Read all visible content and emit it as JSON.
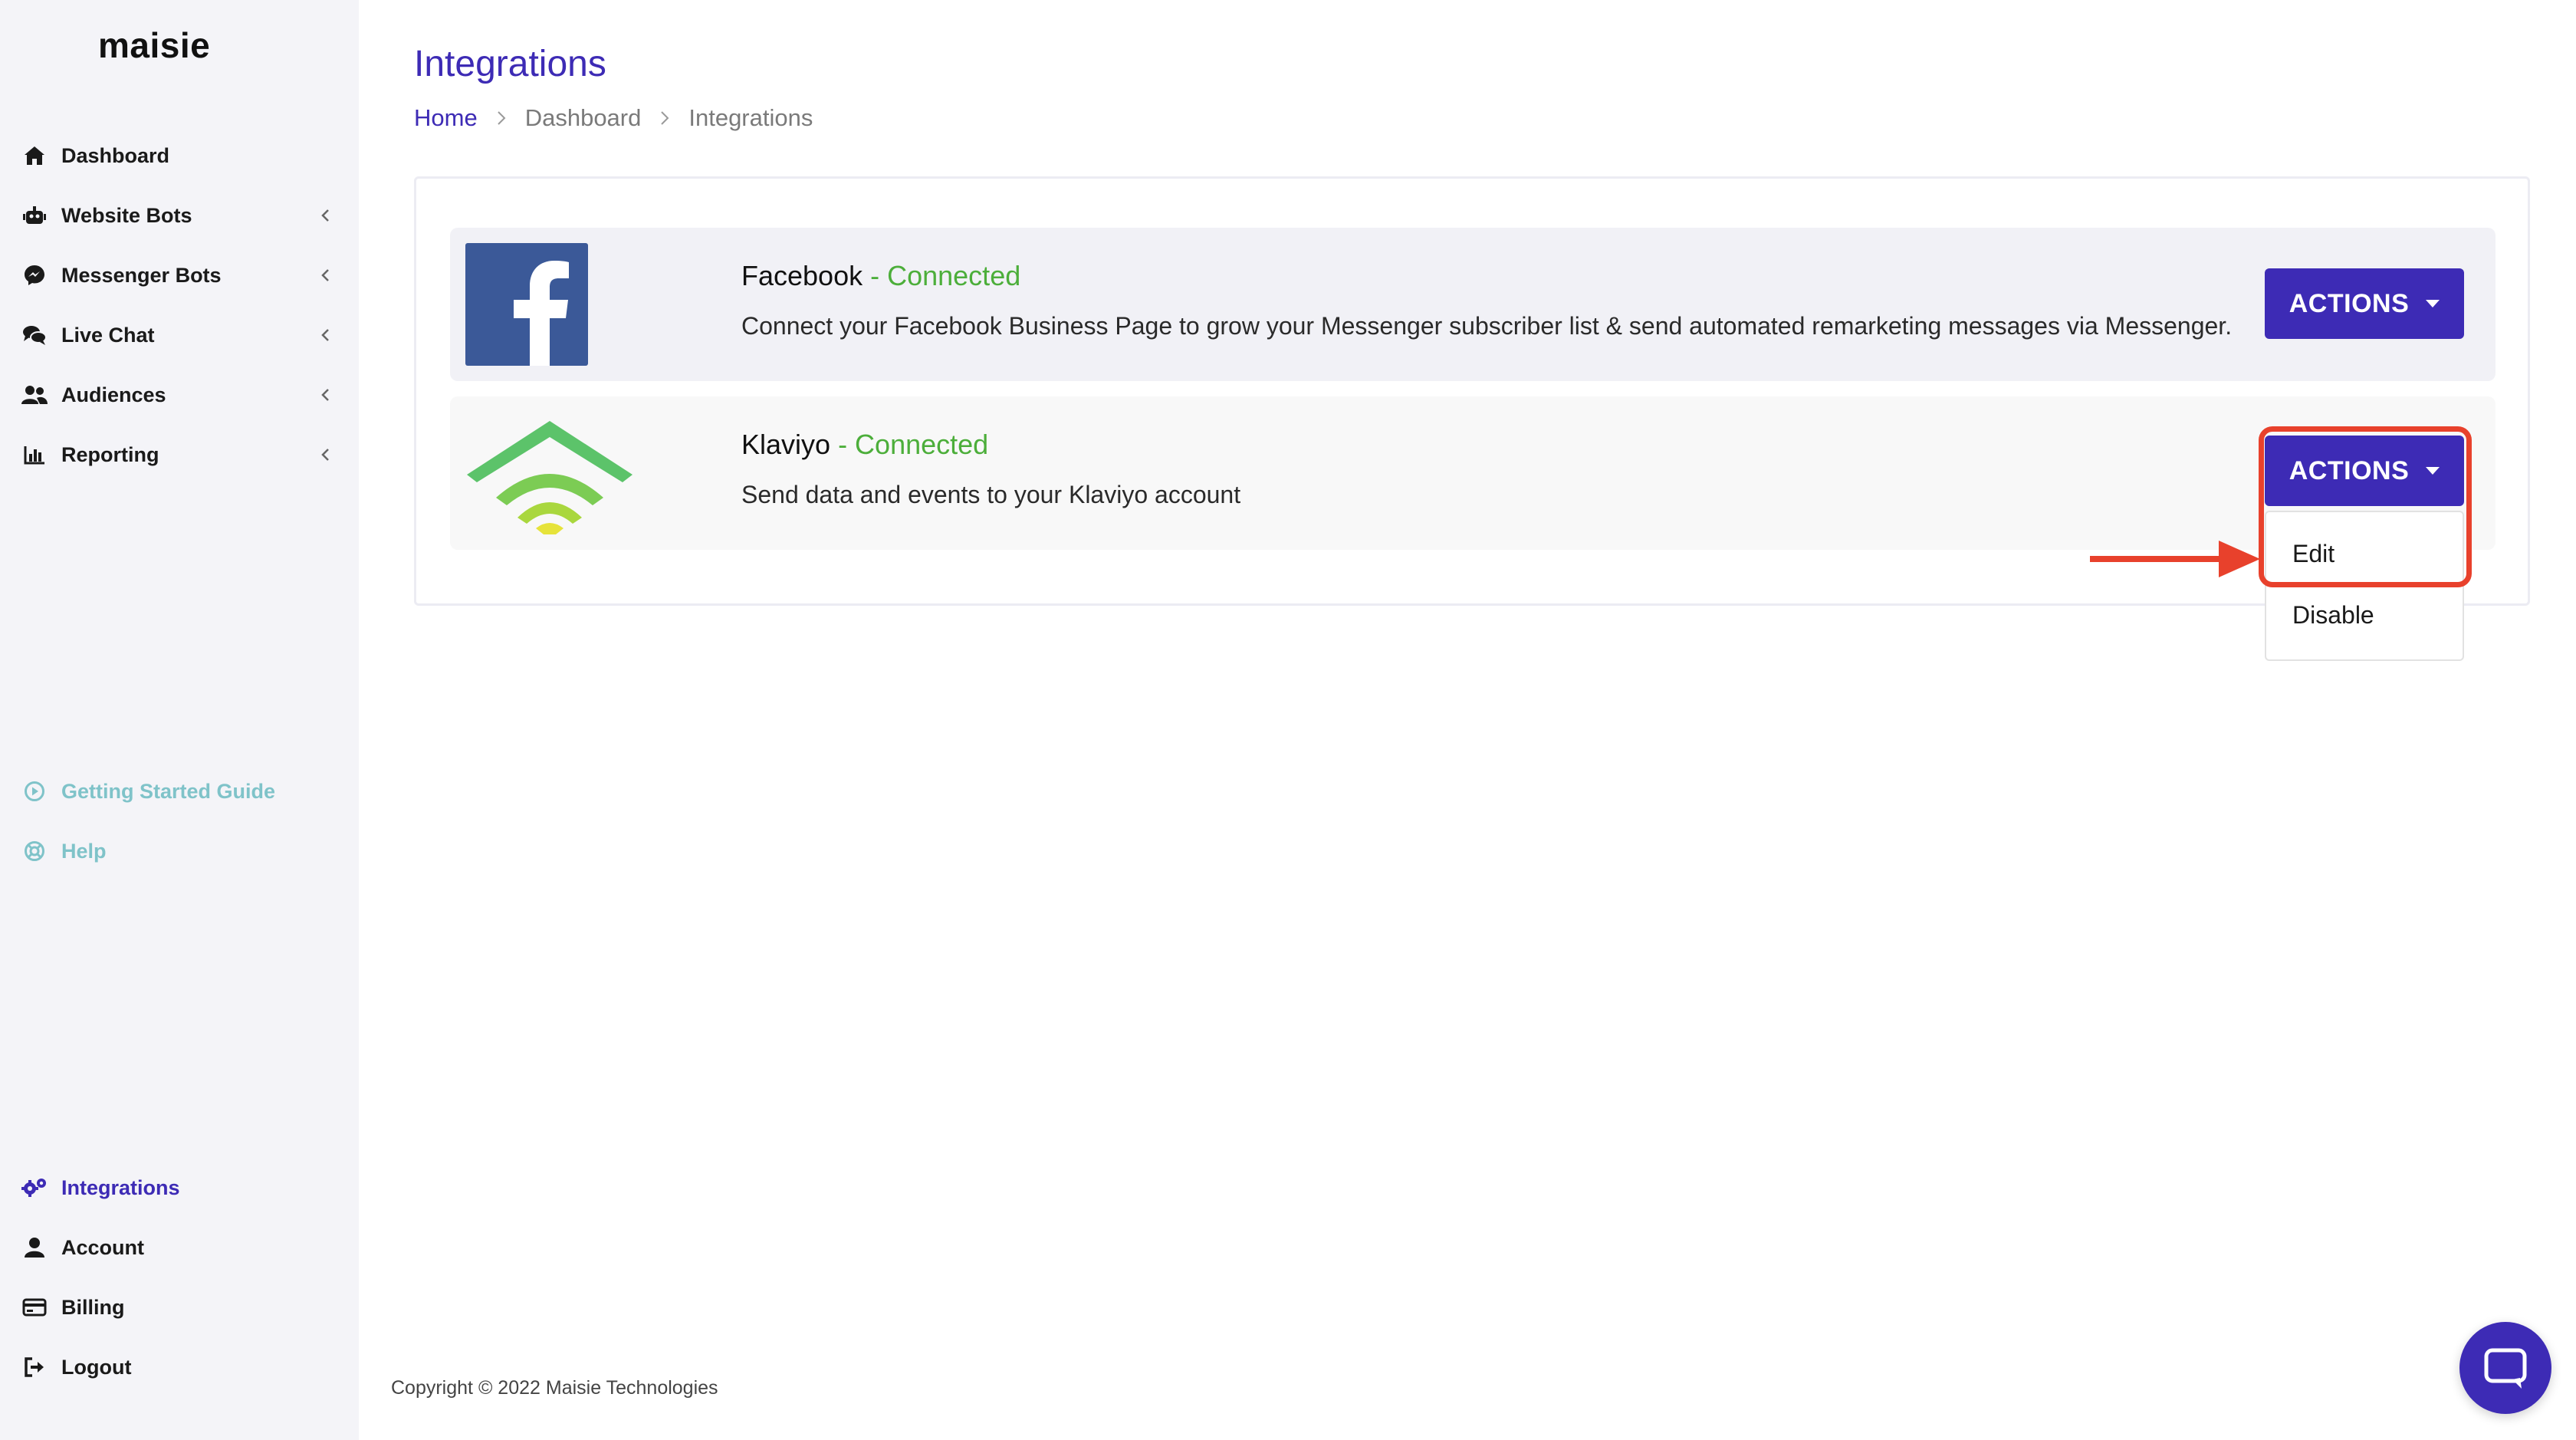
{
  "app": {
    "logo": "maisie"
  },
  "sidebar": {
    "items": [
      {
        "label": "Dashboard",
        "icon": "home-icon"
      },
      {
        "label": "Website Bots",
        "icon": "robot-icon"
      },
      {
        "label": "Messenger Bots",
        "icon": "messenger-icon"
      },
      {
        "label": "Live Chat",
        "icon": "chat-icon"
      },
      {
        "label": "Audiences",
        "icon": "users-icon"
      },
      {
        "label": "Reporting",
        "icon": "chart-icon"
      }
    ],
    "help_items": [
      {
        "label": "Getting Started Guide",
        "icon": "play-circle-icon"
      },
      {
        "label": "Help",
        "icon": "lifebuoy-icon"
      }
    ],
    "bottom_items": [
      {
        "label": "Integrations",
        "icon": "gears-icon"
      },
      {
        "label": "Account",
        "icon": "user-icon"
      },
      {
        "label": "Billing",
        "icon": "credit-card-icon"
      },
      {
        "label": "Logout",
        "icon": "logout-icon"
      }
    ],
    "active": "Integrations"
  },
  "header": {
    "title": "Integrations",
    "breadcrumb": [
      "Home",
      "Dashboard",
      "Integrations"
    ]
  },
  "integrations": [
    {
      "name": "Facebook",
      "status": " - Connected",
      "description": "Connect your Facebook Business Page to grow your Messenger subscriber list & send automated remarketing messages via Messenger.",
      "action_label": "ACTIONS",
      "logo": "facebook-logo"
    },
    {
      "name": "Klaviyo",
      "status": " - Connected",
      "description": "Send data and events to your Klaviyo account",
      "action_label": "ACTIONS",
      "logo": "klaviyo-logo"
    }
  ],
  "dropdown": {
    "items": [
      "Edit",
      "Disable"
    ]
  },
  "footer": {
    "copyright": "Copyright © 2022 Maisie Technologies"
  },
  "colors": {
    "accent": "#3d2bb5",
    "connected": "#4cae3a",
    "highlight": "#e8412c",
    "facebook": "#3b5998"
  }
}
